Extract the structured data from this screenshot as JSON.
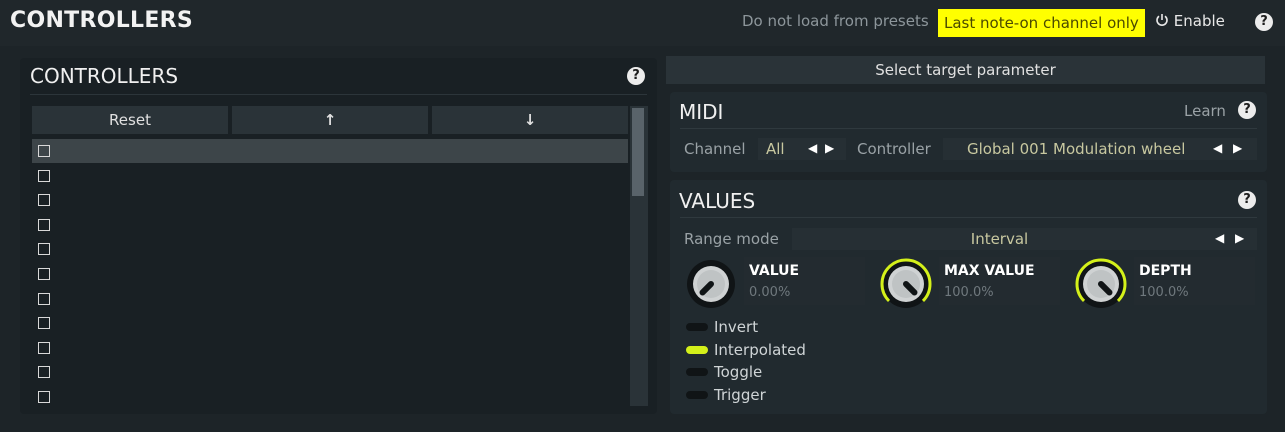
{
  "header": {
    "title": "CONTROLLERS",
    "do_not_load": "Do not load from presets",
    "last_note": "Last note-on channel only",
    "enable": "Enable",
    "help": "?"
  },
  "left_panel": {
    "title": "CONTROLLERS",
    "help": "?",
    "reset_label": "Reset",
    "up_label": "↑",
    "down_label": "↓",
    "row_count": 11,
    "selected_row": 0
  },
  "right": {
    "select_target": "Select target parameter",
    "midi": {
      "title": "MIDI",
      "learn": "Learn",
      "help": "?",
      "channel_label": "Channel",
      "channel_value": "All",
      "controller_label": "Controller",
      "controller_value": "Global 001 Modulation wheel"
    },
    "values": {
      "title": "VALUES",
      "help": "?",
      "range_mode_label": "Range mode",
      "range_mode_value": "Interval",
      "knobs": [
        {
          "label": "VALUE",
          "value": "0.00%",
          "fraction": 0.0
        },
        {
          "label": "MAX VALUE",
          "value": "100.0%",
          "fraction": 1.0
        },
        {
          "label": "DEPTH",
          "value": "100.0%",
          "fraction": 1.0
        }
      ],
      "toggles": [
        {
          "label": "Invert",
          "on": false
        },
        {
          "label": "Interpolated",
          "on": true
        },
        {
          "label": "Toggle",
          "on": false
        },
        {
          "label": "Trigger",
          "on": false
        }
      ]
    }
  },
  "colors": {
    "accent": "#d4f01a",
    "highlight": "#ffff00",
    "background": "#1d2428"
  }
}
